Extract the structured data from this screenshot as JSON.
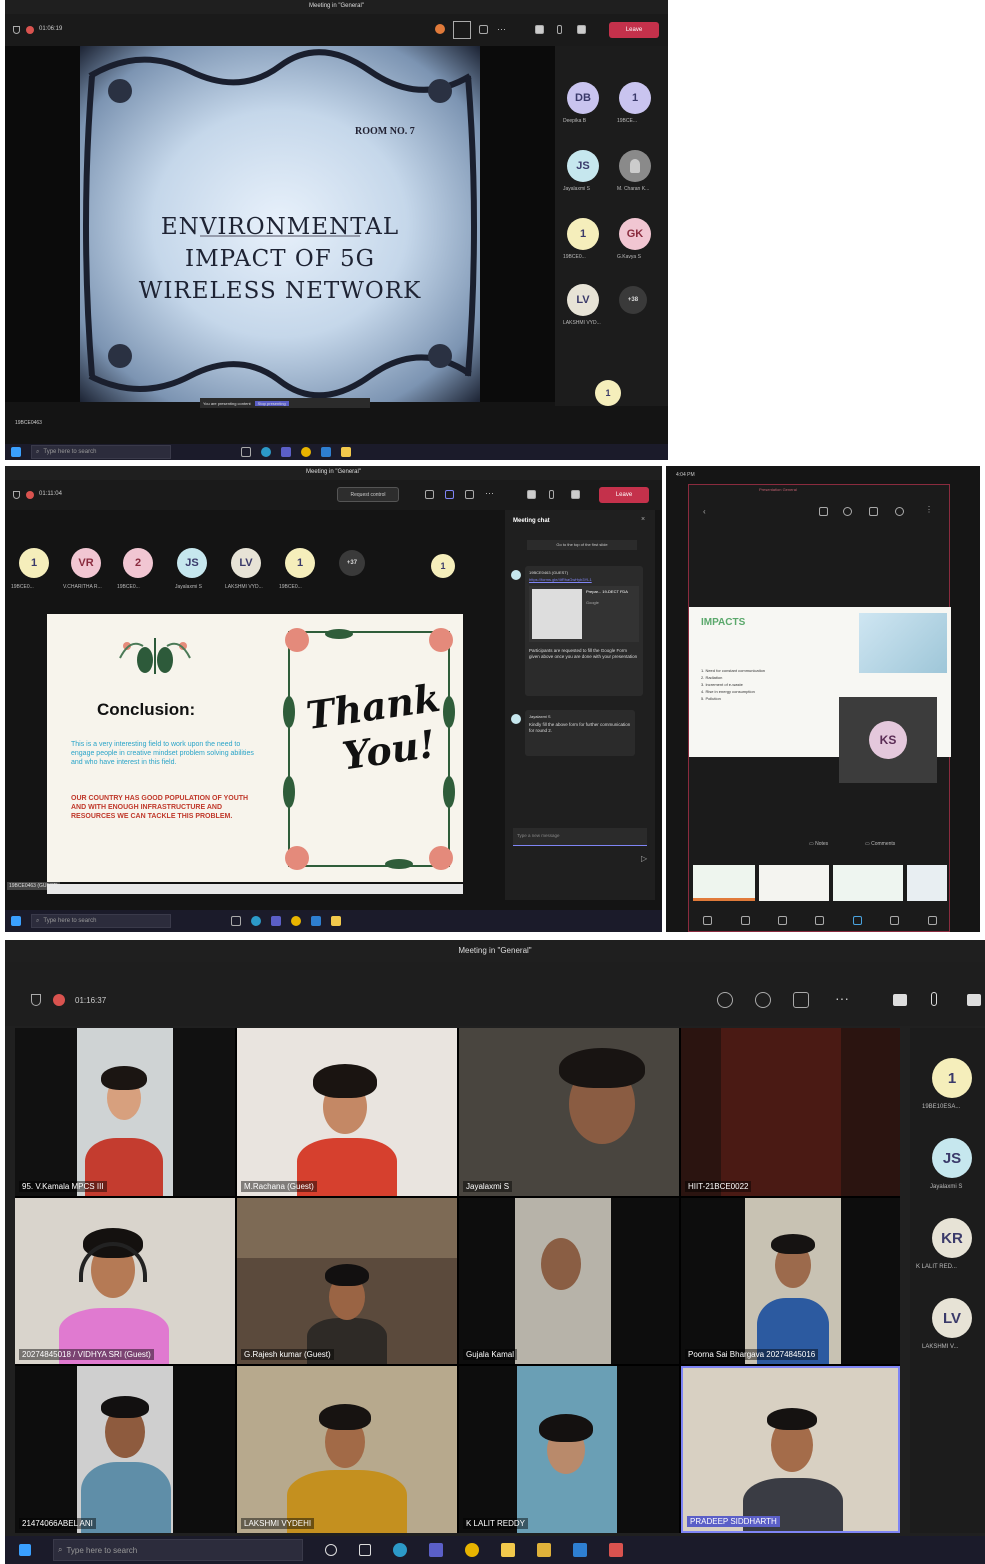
{
  "panel1": {
    "window_title": "Meeting in \"General\"",
    "timer": "01:06:19",
    "leave_label": "Leave",
    "slide": {
      "room_label": "ROOM NO. 7",
      "title_line1": "ENVIRONMENTAL",
      "title_line2": "IMPACT OF 5G",
      "title_line3": "WIRELESS NETWORK"
    },
    "participants": [
      {
        "initials": "DB",
        "name": "Deepika B"
      },
      {
        "initials": "1",
        "name": "19BCE..."
      },
      {
        "initials": "JS",
        "name": "Jayalaxmi S"
      },
      {
        "initials": "",
        "name": "M. Charan K..."
      },
      {
        "initials": "1",
        "name": "19BCE0..."
      },
      {
        "initials": "GK",
        "name": "G.Kavya S"
      },
      {
        "initials": "LV",
        "name": "LAKSHMI VYD..."
      },
      {
        "initials": "+38",
        "name": ""
      }
    ],
    "bottom_avatar": "1",
    "presenter_label": "19BCE0463",
    "search_placeholder": "Type here to search",
    "share_notice": "You are presenting content",
    "stop_label": "Stop presenting"
  },
  "panel2": {
    "window_title": "Meeting in \"General\"",
    "timer": "01:11:04",
    "request_control": "Request control",
    "leave_label": "Leave",
    "participants": [
      {
        "initials": "1",
        "name": "19BCE0..."
      },
      {
        "initials": "VR",
        "name": "V.CHARITHA R..."
      },
      {
        "initials": "2",
        "name": "19BCE0..."
      },
      {
        "initials": "JS",
        "name": "Jayalaxmi S"
      },
      {
        "initials": "LV",
        "name": "LAKSHMI VYD..."
      },
      {
        "initials": "1",
        "name": "19BCE0..."
      },
      {
        "initials": "+37",
        "name": ""
      }
    ],
    "corner_avatar": "1",
    "slide": {
      "heading": "Conclusion:",
      "body_blue": "This is a very interesting field to work upon the need to engage people in creative mindset problem solving abilities and who have interest in this field.",
      "body_red": "OUR COUNTRY HAS GOOD POPULATION OF YOUTH AND WITH ENOUGH INFRASTRUCTURE AND RESOURCES WE CAN TACKLE THIS PROBLEM.",
      "thank1": "Thank",
      "thank2": "You!"
    },
    "chat": {
      "title": "Meeting chat",
      "jump_label": "Go to the top of the first slide",
      "msg1_sender": "19BCE0463 (GUEST)",
      "msg1_link": "https://forms.gle/4tRhaGwHyb3YL1",
      "msg1_card_title": "Prepar... 19-DECT FDA",
      "msg1_card_sub": "Google",
      "msg1_text": "Participants are requested to fill the Google Form given above once you are done with your presentation",
      "msg2_sender": "Jayalaxmi S",
      "msg2_text": "Kindly fill the above form for further communication for round 2.",
      "input_placeholder": "Type a new message"
    },
    "presenter_label": "19BCE0463 (GUEST)",
    "search_placeholder": "Type here to search"
  },
  "panel3": {
    "status_time": "4:04 PM",
    "subtitle": "Presentation  General",
    "slide_heading": "IMPACTS",
    "bullets": [
      "1. Need for constant communication",
      "2. Radiation",
      "3. Increment of e-waste",
      "4. Rise in energy consumption",
      "5. Pollution"
    ],
    "avatar_initials": "KS",
    "notes_label": "Notes",
    "comments_label": "Comments"
  },
  "panel4": {
    "window_title": "Meeting in \"General\"",
    "timer": "01:16:37",
    "tiles": [
      {
        "label": "95. V.Kamala MPCS III"
      },
      {
        "label": "M.Rachana (Guest)"
      },
      {
        "label": "Jayalaxmi S"
      },
      {
        "label": "HIIT-21BCE0022"
      },
      {
        "label": "20274845018 / VIDHYA SRI (Guest)"
      },
      {
        "label": "G.Rajesh kumar (Guest)"
      },
      {
        "label": "Gujala Kamal"
      },
      {
        "label": "Poorna Sai Bhargava 20274845016"
      },
      {
        "label": "21474066ABEL ANI"
      },
      {
        "label": "LAKSHMI VYDEHI"
      },
      {
        "label": "K LALIT REDDY"
      },
      {
        "label": "PRADEEP SIDDHARTH"
      }
    ],
    "roster": [
      {
        "initials": "1",
        "name": "19BE10ESA..."
      },
      {
        "initials": "JS",
        "name": "Jayalaxmi S"
      },
      {
        "initials": "KR",
        "name": "K LALIT RED..."
      },
      {
        "initials": "LV",
        "name": "LAKSHMI V..."
      }
    ],
    "search_placeholder": "Type here to search"
  },
  "colors": {
    "leave_red": "#c4314b",
    "teams_dark": "#141414",
    "avatar_lavender": "#c9c4ef",
    "avatar_yellow": "#f5eebb",
    "avatar_pink": "#f1c6d2",
    "avatar_teal": "#c6e7ee"
  },
  "icons": [
    "shield-icon",
    "record-icon",
    "people-icon",
    "chat-icon",
    "reactions-icon",
    "more-icon",
    "camera-icon",
    "mic-icon",
    "share-icon",
    "windows-start-icon",
    "search-icon",
    "task-view-icon",
    "edge-icon",
    "store-icon"
  ]
}
